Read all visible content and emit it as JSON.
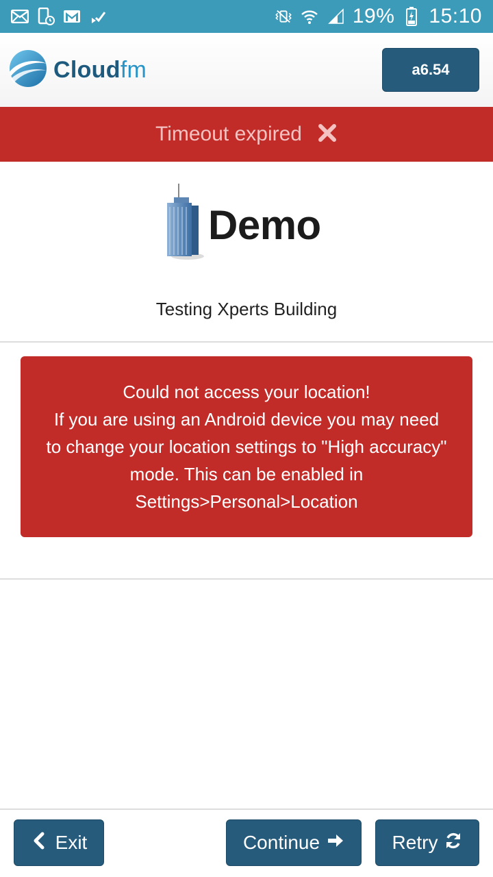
{
  "status_bar": {
    "battery_percent": "19%",
    "time": "15:10",
    "icons": [
      "email-icon",
      "phone-sync-icon",
      "gmail-icon",
      "task-check-icon",
      "vibrate-mute-icon",
      "wifi-icon",
      "signal-icon",
      "battery-charging-icon"
    ]
  },
  "header": {
    "brand": {
      "main": "Cloud",
      "accent": "fm"
    },
    "version_label": "a6.54"
  },
  "banner": {
    "text": "Timeout expired",
    "close_icon": "close-icon"
  },
  "site": {
    "logo_text": "Demo",
    "building_name": "Testing Xperts Building"
  },
  "error": {
    "line1": "Could not access your location!",
    "line2": "If you are using an Android device you may need to change your location settings to \"High accuracy\" mode. This can be enabled in Settings>Personal>Location"
  },
  "footer": {
    "exit_label": "Exit",
    "continue_label": "Continue",
    "retry_label": "Retry"
  },
  "colors": {
    "status_bar": "#3b9bb9",
    "primary_button": "#265b7b",
    "danger": "#c12b28"
  }
}
